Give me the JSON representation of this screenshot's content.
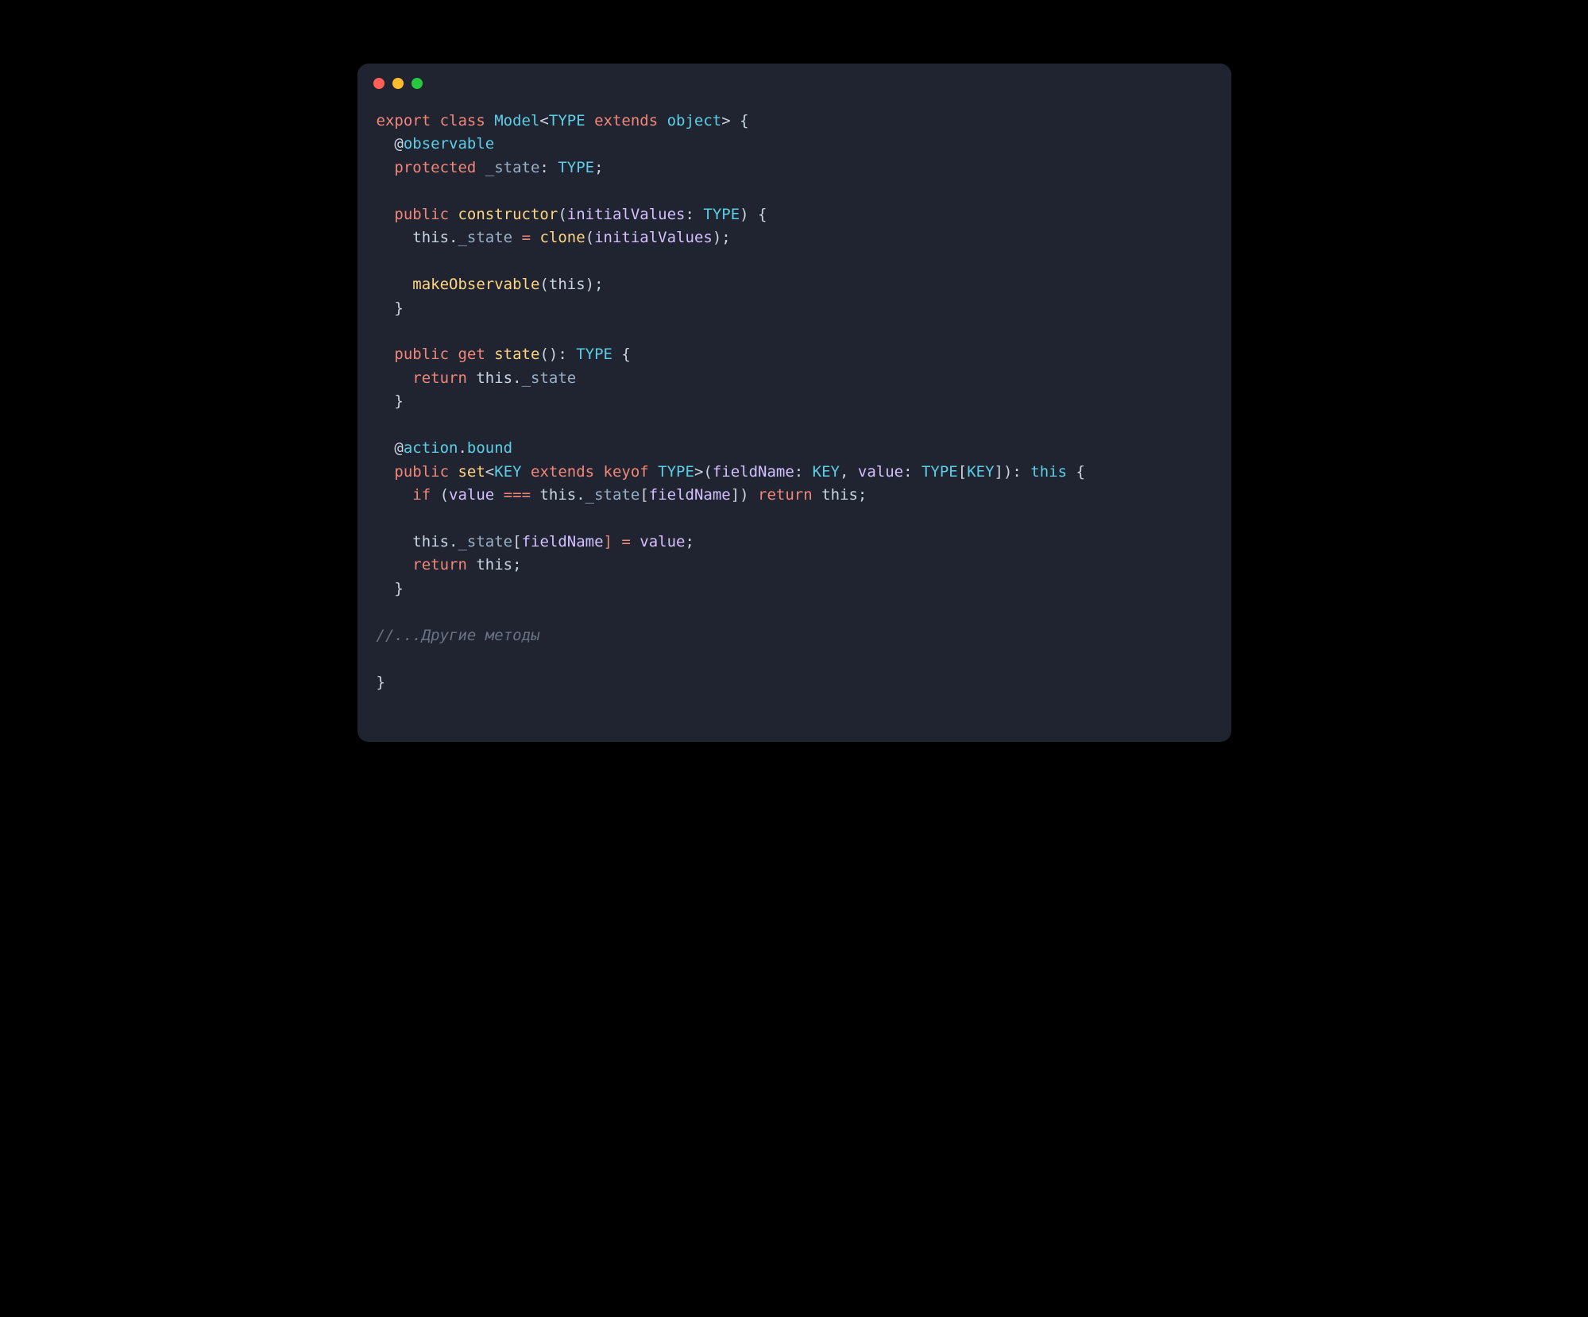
{
  "window": {
    "dots": [
      "close",
      "minimize",
      "zoom"
    ]
  },
  "code": {
    "lines": [
      [
        {
          "t": "export ",
          "c": "kw"
        },
        {
          "t": "class ",
          "c": "kw"
        },
        {
          "t": "Model",
          "c": "cls"
        },
        {
          "t": "<",
          "c": "punc"
        },
        {
          "t": "TYPE",
          "c": "type"
        },
        {
          "t": " extends ",
          "c": "kw"
        },
        {
          "t": "object",
          "c": "type"
        },
        {
          "t": "> {",
          "c": "punc"
        }
      ],
      [
        {
          "t": "  @",
          "c": "punc"
        },
        {
          "t": "observable",
          "c": "dec"
        }
      ],
      [
        {
          "t": "  ",
          "c": "punc"
        },
        {
          "t": "protected ",
          "c": "kw"
        },
        {
          "t": "_state",
          "c": "prop"
        },
        {
          "t": ": ",
          "c": "punc"
        },
        {
          "t": "TYPE",
          "c": "type"
        },
        {
          "t": ";",
          "c": "punc"
        }
      ],
      [
        {
          "t": "",
          "c": "punc"
        }
      ],
      [
        {
          "t": "  ",
          "c": "punc"
        },
        {
          "t": "public ",
          "c": "kw"
        },
        {
          "t": "constructor",
          "c": "fn"
        },
        {
          "t": "(",
          "c": "punc"
        },
        {
          "t": "initialValues",
          "c": "param"
        },
        {
          "t": ": ",
          "c": "punc"
        },
        {
          "t": "TYPE",
          "c": "type"
        },
        {
          "t": ") {",
          "c": "punc"
        }
      ],
      [
        {
          "t": "    ",
          "c": "punc"
        },
        {
          "t": "this",
          "c": "this"
        },
        {
          "t": ".",
          "c": "punc"
        },
        {
          "t": "_state",
          "c": "prop"
        },
        {
          "t": " = ",
          "c": "op"
        },
        {
          "t": "clone",
          "c": "fn"
        },
        {
          "t": "(",
          "c": "punc"
        },
        {
          "t": "initialValues",
          "c": "param"
        },
        {
          "t": ");",
          "c": "punc"
        }
      ],
      [
        {
          "t": "",
          "c": "punc"
        }
      ],
      [
        {
          "t": "    ",
          "c": "punc"
        },
        {
          "t": "makeObservable",
          "c": "fn"
        },
        {
          "t": "(",
          "c": "punc"
        },
        {
          "t": "this",
          "c": "this"
        },
        {
          "t": ");",
          "c": "punc"
        }
      ],
      [
        {
          "t": "  }",
          "c": "punc"
        }
      ],
      [
        {
          "t": "",
          "c": "punc"
        }
      ],
      [
        {
          "t": "  ",
          "c": "punc"
        },
        {
          "t": "public ",
          "c": "kw"
        },
        {
          "t": "get ",
          "c": "kw"
        },
        {
          "t": "state",
          "c": "fn"
        },
        {
          "t": "(): ",
          "c": "punc"
        },
        {
          "t": "TYPE",
          "c": "type"
        },
        {
          "t": " {",
          "c": "punc"
        }
      ],
      [
        {
          "t": "    ",
          "c": "punc"
        },
        {
          "t": "return ",
          "c": "kw"
        },
        {
          "t": "this",
          "c": "this"
        },
        {
          "t": ".",
          "c": "punc"
        },
        {
          "t": "_state",
          "c": "prop"
        }
      ],
      [
        {
          "t": "  }",
          "c": "punc"
        }
      ],
      [
        {
          "t": "",
          "c": "punc"
        }
      ],
      [
        {
          "t": "  @",
          "c": "punc"
        },
        {
          "t": "action",
          "c": "dec"
        },
        {
          "t": ".",
          "c": "punc"
        },
        {
          "t": "bound",
          "c": "dec"
        }
      ],
      [
        {
          "t": "  ",
          "c": "punc"
        },
        {
          "t": "public ",
          "c": "kw"
        },
        {
          "t": "set",
          "c": "fn"
        },
        {
          "t": "<",
          "c": "punc"
        },
        {
          "t": "KEY",
          "c": "type"
        },
        {
          "t": " extends ",
          "c": "kw"
        },
        {
          "t": "keyof ",
          "c": "kw"
        },
        {
          "t": "TYPE",
          "c": "type"
        },
        {
          "t": ">(",
          "c": "punc"
        },
        {
          "t": "fieldName",
          "c": "param"
        },
        {
          "t": ": ",
          "c": "punc"
        },
        {
          "t": "KEY",
          "c": "type"
        },
        {
          "t": ", ",
          "c": "punc"
        },
        {
          "t": "value",
          "c": "param"
        },
        {
          "t": ": ",
          "c": "punc"
        },
        {
          "t": "TYPE",
          "c": "type"
        },
        {
          "t": "[",
          "c": "punc"
        },
        {
          "t": "KEY",
          "c": "type"
        },
        {
          "t": "]): ",
          "c": "punc"
        },
        {
          "t": "this",
          "c": "type"
        },
        {
          "t": " {",
          "c": "punc"
        }
      ],
      [
        {
          "t": "    ",
          "c": "punc"
        },
        {
          "t": "if ",
          "c": "kw"
        },
        {
          "t": "(",
          "c": "punc"
        },
        {
          "t": "value",
          "c": "param"
        },
        {
          "t": " === ",
          "c": "op"
        },
        {
          "t": "this",
          "c": "this"
        },
        {
          "t": ".",
          "c": "punc"
        },
        {
          "t": "_state",
          "c": "prop"
        },
        {
          "t": "[",
          "c": "punc"
        },
        {
          "t": "fieldName",
          "c": "param"
        },
        {
          "t": "]) ",
          "c": "punc"
        },
        {
          "t": "return ",
          "c": "kw"
        },
        {
          "t": "this",
          "c": "this"
        },
        {
          "t": ";",
          "c": "punc"
        }
      ],
      [
        {
          "t": "",
          "c": "punc"
        }
      ],
      [
        {
          "t": "    ",
          "c": "punc"
        },
        {
          "t": "this",
          "c": "this"
        },
        {
          "t": ".",
          "c": "punc"
        },
        {
          "t": "_state",
          "c": "prop"
        },
        {
          "t": "[",
          "c": "punc"
        },
        {
          "t": "fieldName",
          "c": "param"
        },
        {
          "t": "] = ",
          "c": "op"
        },
        {
          "t": "value",
          "c": "param"
        },
        {
          "t": ";",
          "c": "punc"
        }
      ],
      [
        {
          "t": "    ",
          "c": "punc"
        },
        {
          "t": "return ",
          "c": "kw"
        },
        {
          "t": "this",
          "c": "this"
        },
        {
          "t": ";",
          "c": "punc"
        }
      ],
      [
        {
          "t": "  }",
          "c": "punc"
        }
      ],
      [
        {
          "t": "",
          "c": "punc"
        }
      ],
      [
        {
          "t": "//...Другие методы",
          "c": "comm"
        }
      ],
      [
        {
          "t": "",
          "c": "punc"
        }
      ],
      [
        {
          "t": "}",
          "c": "punc"
        }
      ]
    ]
  }
}
